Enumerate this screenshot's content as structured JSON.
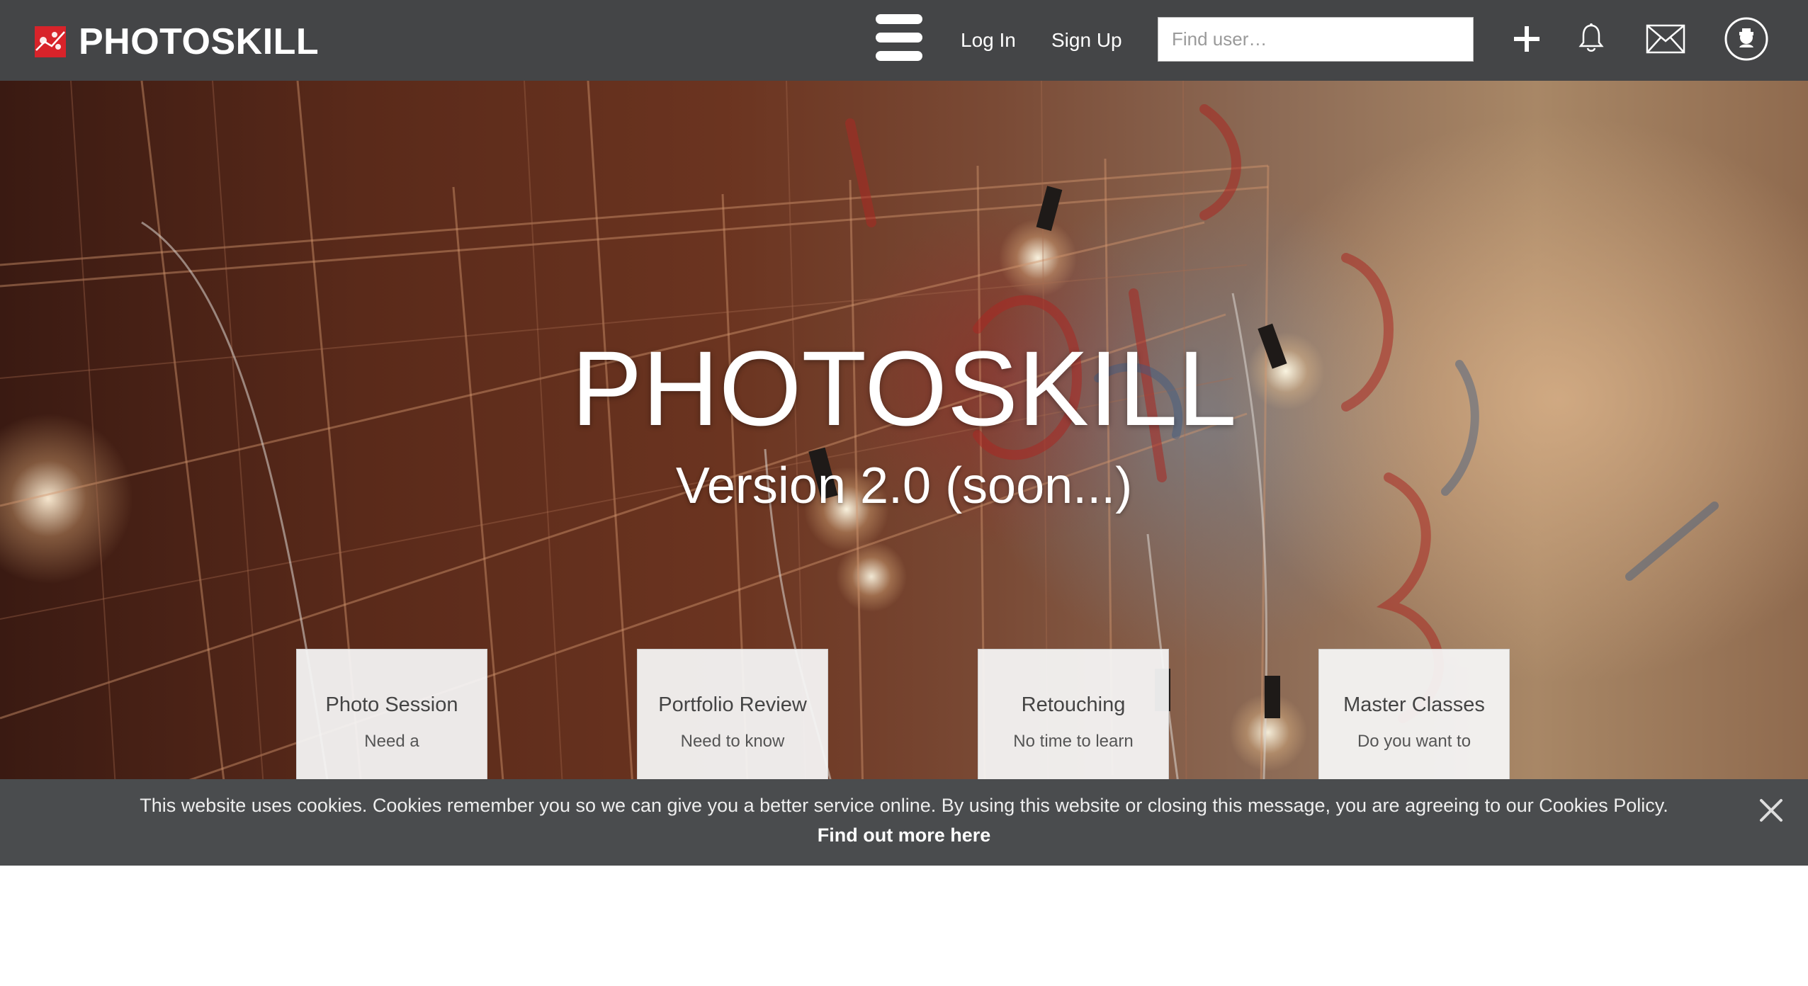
{
  "header": {
    "brand_name": "PHOTOSKILL",
    "logo_icon": "photoskill-logo-icon",
    "menu_icon": "hamburger-menu-icon",
    "login_label": "Log In",
    "signup_label": "Sign Up",
    "search": {
      "placeholder": "Find user…",
      "value": ""
    },
    "icons": [
      "plus-icon",
      "bell-icon",
      "envelope-icon",
      "user-avatar-icon"
    ]
  },
  "hero": {
    "title": "PHOTOSKILL",
    "subtitle": "Version 2.0 (soon...)",
    "cards": [
      {
        "title": "Photo Session",
        "text": "Need a"
      },
      {
        "title": "Portfolio Review",
        "text": "Need to know"
      },
      {
        "title": "Retouching",
        "text": "No time to learn"
      },
      {
        "title": "Master Classes",
        "text": "Do you want to"
      }
    ]
  },
  "cookie_bar": {
    "message": "This website uses cookies. Cookies remember you so we can give you a better service online. By using this website or closing this message, you are agreeing to our Cookies Policy.",
    "link_label": "Find out more here",
    "close_icon": "close-icon"
  },
  "colors": {
    "topbar": "#444547",
    "brand_red": "#d8232a",
    "cookie_bar": "#4a4c4e"
  }
}
